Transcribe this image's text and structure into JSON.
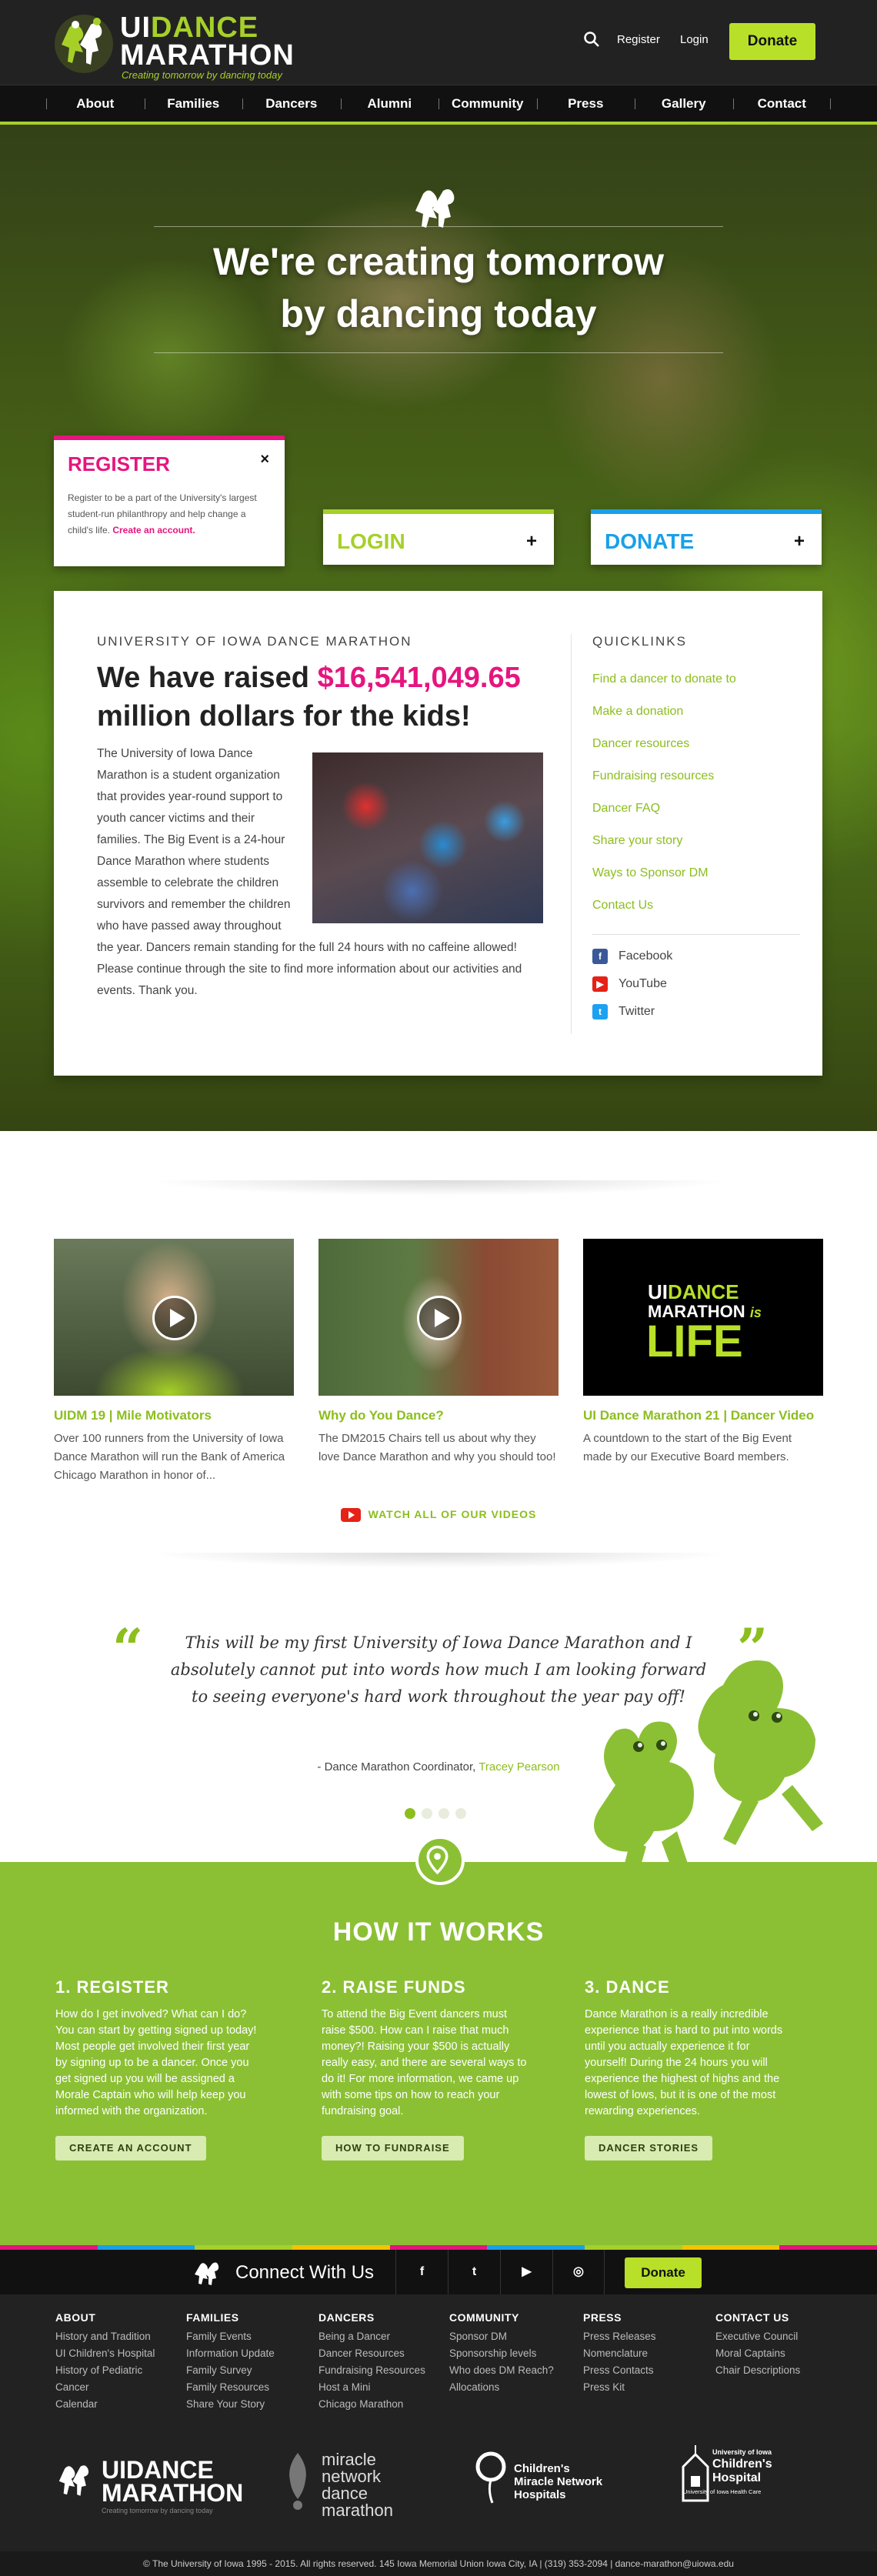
{
  "header": {
    "logo_ui": "UI",
    "logo_dance": "DANCE",
    "logo_marathon": "MARATHON",
    "logo_tagline": "Creating tomorrow by dancing today",
    "register": "Register",
    "login": "Login",
    "donate": "Donate"
  },
  "nav": [
    "About",
    "Families",
    "Dancers",
    "Alumni",
    "Community",
    "Press",
    "Gallery",
    "Contact"
  ],
  "hero": {
    "title_line1": "We're creating tomorrow",
    "title_line2": "by dancing today"
  },
  "cards": {
    "register": {
      "title": "REGISTER",
      "close": "×",
      "text": "Register to be a part of the University's largest student-run philanthropy and help change a child's life.",
      "link": "Create an account."
    },
    "login": {
      "title": "LOGIN",
      "plus": "+"
    },
    "donate": {
      "title": "DONATE",
      "plus": "+"
    }
  },
  "panel": {
    "kicker": "UNIVERSITY OF IOWA DANCE MARATHON",
    "raised_prefix": "We have raised",
    "amount": "$16,541,049.65",
    "raised_suffix": "million dollars for the kids!",
    "about": "The University of Iowa Dance Marathon is a student organization that provides year-round support to youth cancer victims and their families. The Big Event is a 24-hour Dance Marathon where students assemble to celebrate the children survivors and remember the children who have passed away throughout the year. Dancers remain standing for the full 24 hours with no caffeine allowed! Please continue through the site to find more information about our activities and events. Thank you."
  },
  "quicklinks": {
    "title": "QUICKLINKS",
    "items": [
      "Find a dancer to donate to",
      "Make a donation",
      "Dancer resources",
      "Fundraising resources",
      "Dancer FAQ",
      "Share your story",
      "Ways to Sponsor DM",
      "Contact Us"
    ],
    "social": [
      "Facebook",
      "YouTube",
      "Twitter"
    ],
    "colors": {
      "facebook": "#3b5998",
      "youtube": "#e62117",
      "twitter": "#1da1f2"
    }
  },
  "videos": [
    {
      "title": "UIDM 19 | Mile Motivators",
      "desc": "Over 100 runners from the University of Iowa Dance Marathon will run the Bank of America Chicago Marathon in honor of..."
    },
    {
      "title": "Why do You Dance?",
      "desc": "The DM2015 Chairs tell us about why they love Dance Marathon and why you should too!"
    },
    {
      "title": "UI Dance Marathon 21 | Dancer Video",
      "desc": "A countdown to the start of the Big Event made by our Executive Board members."
    }
  ],
  "video3_thumb": {
    "ui": "UI",
    "dance": "DANCE",
    "marathon": "MARATHON",
    "is": "is",
    "life": "LIFE"
  },
  "watch_all": "WATCH ALL OF OUR VIDEOS",
  "quote": {
    "open": "“",
    "close": "”",
    "text": "This will be my first University of Iowa Dance Marathon and I absolutely cannot put into words how much I am looking forward to seeing everyone's hard work throughout the year pay off!",
    "attribution": "- Dance Marathon Coordinator,",
    "name": "Tracey Pearson",
    "active_slide": 1,
    "slide_count": 4
  },
  "how": {
    "title": "HOW IT WORKS",
    "steps": [
      {
        "title": "1. REGISTER",
        "text": "How do I get involved? What can I do? You can start by getting signed up today! Most people get involved their first year by signing up to be a dancer. Once you get signed up you will be assigned a Morale Captain who will help keep you informed with the organization.",
        "button": "CREATE AN ACCOUNT"
      },
      {
        "title": "2. RAISE FUNDS",
        "text": "To attend the Big Event dancers must raise $500. How can I raise that much money?! Raising your $500 is actually really easy, and there are several ways to do it! For more information, we came up with some tips on how to reach your fundraising goal.",
        "button": "HOW TO FUNDRAISE"
      },
      {
        "title": "3. DANCE",
        "text": "Dance Marathon is a really incredible experience that is hard to put into words until you actually experience it for yourself! During the 24 hours you will experience the highest of highs and the lowest of lows, but it is one of the most rewarding experiences.",
        "button": "DANCER STORIES"
      }
    ]
  },
  "connect": {
    "title": "Connect With Us",
    "social": [
      "f",
      "t",
      "▶",
      "◎"
    ],
    "donate": "Donate"
  },
  "stripe_colors": [
    "#e5157e",
    "#1aa0e8",
    "#a6d028",
    "#f5c400",
    "#e5157e",
    "#1aa0e8",
    "#a6d028",
    "#f5c400",
    "#e5157e"
  ],
  "footer": {
    "columns": [
      {
        "head": "ABOUT",
        "links": [
          "History and Tradition",
          "UI Children's Hospital",
          "History of Pediatric Cancer",
          "Calendar"
        ]
      },
      {
        "head": "FAMILIES",
        "links": [
          "Family Events",
          "Information Update",
          "Family Survey",
          "Family Resources",
          "Share Your Story"
        ]
      },
      {
        "head": "DANCERS",
        "links": [
          "Being a Dancer",
          "Dancer Resources",
          "Fundraising Resources",
          "Host a Mini",
          "Chicago Marathon"
        ]
      },
      {
        "head": "COMMUNITY",
        "links": [
          "Sponsor DM",
          "Sponsorship levels",
          "Who does DM Reach?",
          "Allocations"
        ]
      },
      {
        "head": "PRESS",
        "links": [
          "Press Releases",
          "Nomenclature",
          "Press Contacts",
          "Press Kit"
        ]
      },
      {
        "head": "CONTACT US",
        "links": [
          "Executive Council",
          "Moral Captains",
          "Chair Descriptions"
        ]
      }
    ],
    "partners": {
      "uidm_tag": "Creating tomorrow by dancing today",
      "mn_line1": "miracle",
      "mn_line2": "network",
      "mn_line3": "dance",
      "mn_line4": "marathon",
      "cmn_line1": "Children's",
      "cmn_line2": "Miracle Network",
      "cmn_line3": "Hospitals",
      "ui_line1": "University of Iowa",
      "ui_line2": "Children's",
      "ui_line3": "Hospital",
      "ui_line4": "University of Iowa Health Care"
    },
    "copyright": "© The University of Iowa 1995 - 2015. All rights reserved. 145 Iowa Memorial Union Iowa City, IA  |  (319) 353-2094  |  dance-marathon@uiowa.edu"
  }
}
